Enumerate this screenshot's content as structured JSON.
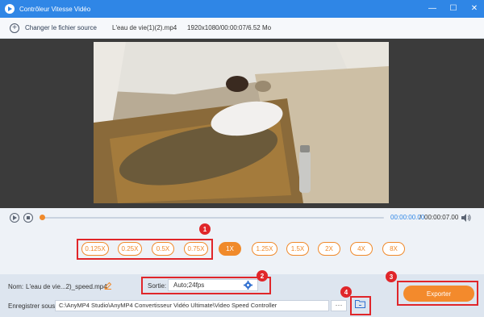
{
  "window": {
    "title": "Contrôleur Vitesse Vidéo",
    "minimize_glyph": "—",
    "maximize_glyph": "☐",
    "close_glyph": "✕"
  },
  "source": {
    "change_label": "Changer le fichier source",
    "file_name": "L'eau de vie(1)(2).mp4",
    "meta": "1920x1080/00:00:07/6.52 Mo"
  },
  "playback": {
    "current_time": "00:00:00.00",
    "separator": "/",
    "total_time": "00:00:07.00",
    "progress": 0
  },
  "speeds": {
    "options": [
      "0.125X",
      "0.25X",
      "0.5X",
      "0.75X",
      "1X",
      "1.25X",
      "1.5X",
      "2X",
      "4X",
      "8X"
    ],
    "selected": "1X"
  },
  "output": {
    "name_label": "Nom:",
    "name_value": "L'eau de vie...2)_speed.mp4",
    "format_label": "Sortie:",
    "format_value": "Auto;24fps",
    "save_label": "Enregistrer sous:",
    "save_path": "C:\\AnyMP4 Studio\\AnyMP4 Convertisseur Vidéo Ultimate\\Video Speed Controller",
    "browse_glyph": "···",
    "export_label": "Exporter"
  },
  "annotations": [
    "1",
    "2",
    "3",
    "4"
  ],
  "colors": {
    "titlebar": "#2f86e6",
    "accent": "#f08a2b",
    "highlight": "#e0262a"
  }
}
